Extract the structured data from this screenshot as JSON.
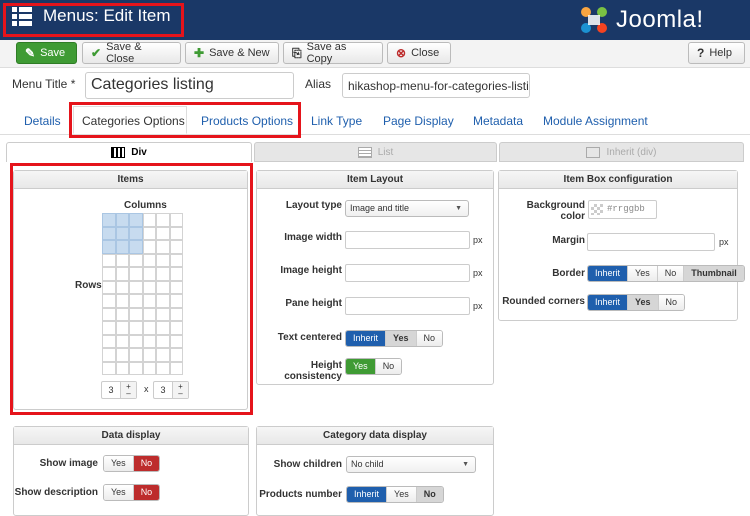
{
  "header": {
    "title": "Menus: Edit Item",
    "logo": "Joomla!"
  },
  "toolbar": {
    "save": "Save",
    "save_close": "Save & Close",
    "save_new": "Save & New",
    "save_copy": "Save as Copy",
    "close": "Close",
    "help": "Help"
  },
  "form": {
    "menu_title_label": "Menu Title *",
    "menu_title_value": "Categories listing",
    "alias_label": "Alias",
    "alias_value": "hikashop-menu-for-categories-listing"
  },
  "tabs": [
    "Details",
    "Categories Options",
    "Products Options",
    "Link Type",
    "Page Display",
    "Metadata",
    "Module Assignment"
  ],
  "layout_tabs": [
    "Div",
    "List",
    "Inherit (div)"
  ],
  "items_panel": {
    "title": "Items",
    "columns_label": "Columns",
    "rows_label": "Rows",
    "cols_value": "3",
    "rows_value": "3",
    "times": "x"
  },
  "item_layout": {
    "title": "Item Layout",
    "layout_type_label": "Layout type",
    "layout_type_value": "Image and title",
    "image_width_label": "Image width",
    "image_height_label": "Image height",
    "pane_height_label": "Pane height",
    "px": "px",
    "text_centered_label": "Text centered",
    "text_centered_options": [
      "Inherit",
      "Yes",
      "No"
    ],
    "height_consistency_label": "Height consistency",
    "height_consistency_options": [
      "Yes",
      "No"
    ]
  },
  "item_box": {
    "title": "Item Box configuration",
    "bg_color_label": "Background color",
    "bg_color_placeholder": "#rrggbb",
    "margin_label": "Margin",
    "px": "px",
    "border_label": "Border",
    "border_options": [
      "Inherit",
      "Yes",
      "No",
      "Thumbnail"
    ],
    "rounded_label": "Rounded corners",
    "rounded_options": [
      "Inherit",
      "Yes",
      "No"
    ]
  },
  "data_display": {
    "title": "Data display",
    "show_image_label": "Show image",
    "show_description_label": "Show description",
    "options": [
      "Yes",
      "No"
    ]
  },
  "category_data": {
    "title": "Category data display",
    "show_children_label": "Show children",
    "show_children_value": "No child",
    "products_number_label": "Products number",
    "products_number_options": [
      "Inherit",
      "Yes",
      "No"
    ]
  },
  "colors": {
    "header_bg": "#1a3867",
    "highlight": "#e5141b",
    "link": "#1f5fad",
    "save_green": "#3f9b34"
  }
}
